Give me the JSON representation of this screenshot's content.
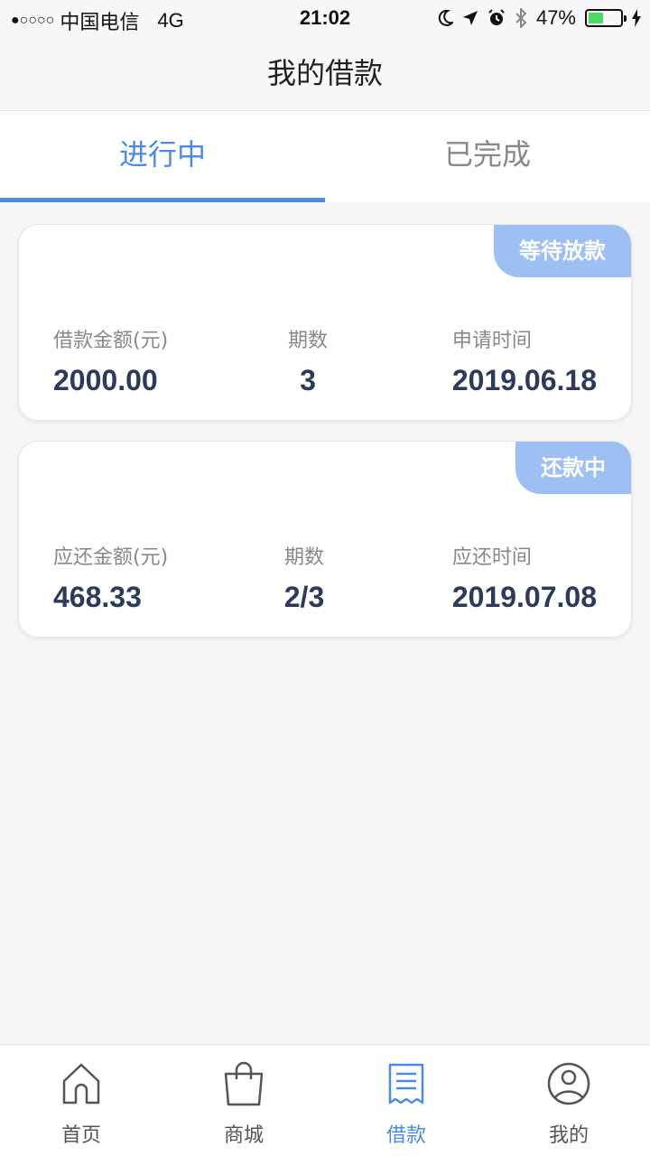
{
  "status_bar": {
    "signal": "●○○○○",
    "carrier": "中国电信",
    "network": "4G",
    "time": "21:02",
    "battery_percent": "47%",
    "battery_level": 0.47
  },
  "header": {
    "title": "我的借款"
  },
  "tabs": [
    {
      "label": "进行中",
      "active": true
    },
    {
      "label": "已完成",
      "active": false
    }
  ],
  "loans": [
    {
      "status": "等待放款",
      "amount_label": "借款金额(元)",
      "amount": "2000.00",
      "periods_label": "期数",
      "periods": "3",
      "date_label": "申请时间",
      "date": "2019.06.18"
    },
    {
      "status": "还款中",
      "amount_label": "应还金额(元)",
      "amount": "468.33",
      "periods_label": "期数",
      "periods": "2/3",
      "date_label": "应还时间",
      "date": "2019.07.08"
    }
  ],
  "tabbar": [
    {
      "label": "首页",
      "icon": "home-icon",
      "active": false
    },
    {
      "label": "商城",
      "icon": "shopping-bag-icon",
      "active": false
    },
    {
      "label": "借款",
      "icon": "receipt-icon",
      "active": true
    },
    {
      "label": "我的",
      "icon": "user-icon",
      "active": false
    }
  ],
  "colors": {
    "accent": "#4a8be6",
    "badge": "#9dbff3",
    "value_text": "#2e3a5a",
    "battery": "#4cd964"
  }
}
